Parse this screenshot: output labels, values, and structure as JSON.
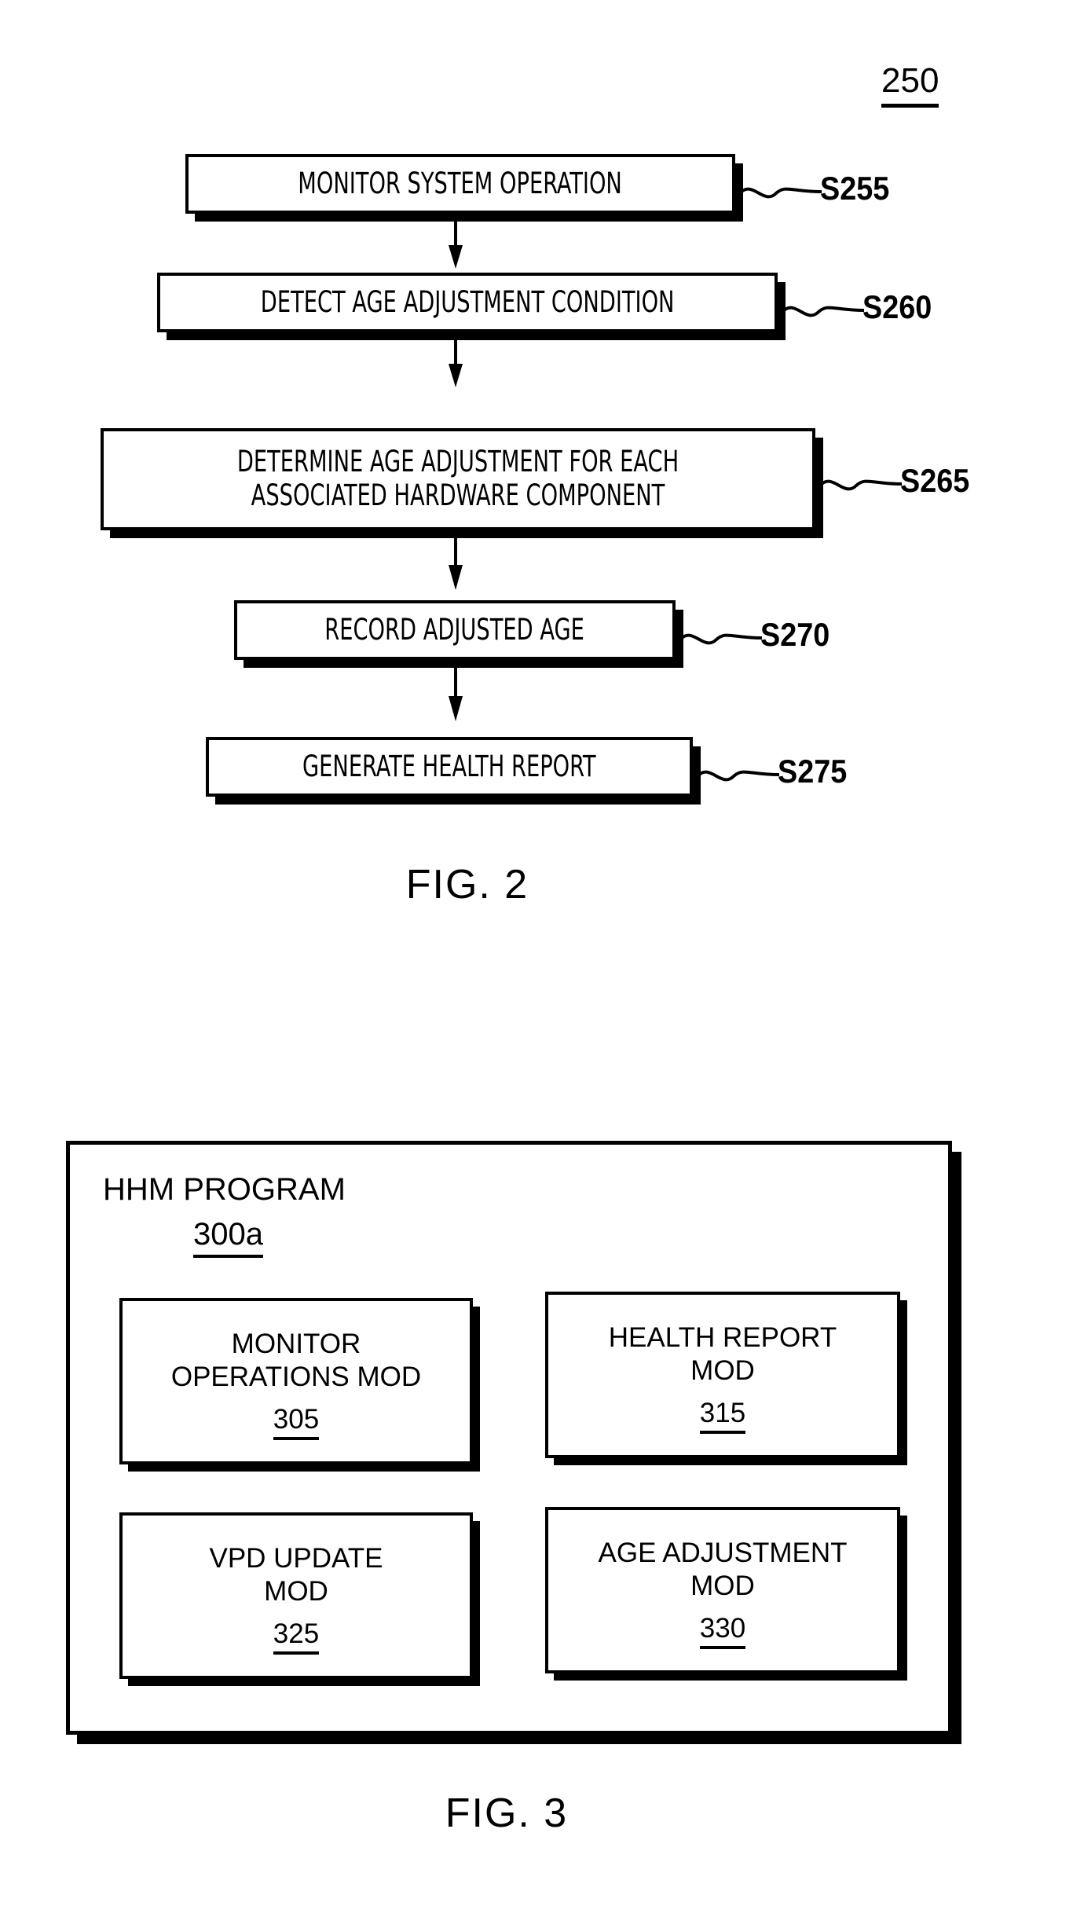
{
  "figure2": {
    "ref_number": "250",
    "caption": "FIG. 2",
    "steps": [
      {
        "text": "MONITOR SYSTEM OPERATION",
        "label": "S255"
      },
      {
        "text": "DETECT AGE ADJUSTMENT CONDITION",
        "label": "S260"
      },
      {
        "text": "DETERMINE AGE ADJUSTMENT FOR EACH ASSOCIATED HARDWARE COMPONENT",
        "label": "S265"
      },
      {
        "text": "RECORD ADJUSTED AGE",
        "label": "S270"
      },
      {
        "text": "GENERATE HEALTH REPORT",
        "label": "S275"
      }
    ]
  },
  "figure3": {
    "caption": "FIG. 3",
    "program_title": "HHM PROGRAM",
    "program_number": "300a",
    "modules": [
      {
        "name": "MONITOR\nOPERATIONS MOD",
        "number": "305"
      },
      {
        "name": "HEALTH REPORT\nMOD",
        "number": "315"
      },
      {
        "name": "VPD UPDATE\nMOD",
        "number": "325"
      },
      {
        "name": "AGE ADJUSTMENT\nMOD",
        "number": "330"
      }
    ]
  },
  "colors": {
    "ink": "#000000",
    "paper": "#ffffff"
  }
}
